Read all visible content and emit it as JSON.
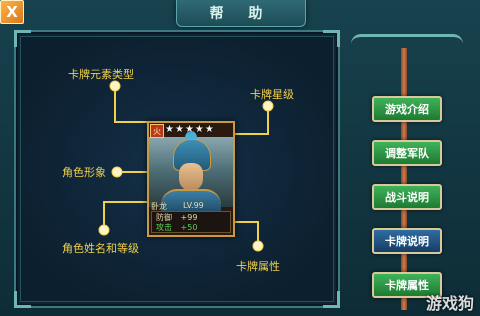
{
  "window": {
    "title": "帮 助",
    "close_label": "X"
  },
  "diagram": {
    "labels": {
      "element_type": "卡牌元素类型",
      "star_level": "卡牌星级",
      "portrait": "角色形象",
      "name_level": "角色姓名和等级",
      "attributes": "卡牌属性"
    }
  },
  "card": {
    "element": "火",
    "stars": [
      "★",
      "★",
      "★",
      "★",
      "★"
    ],
    "name": "卧龙",
    "level": "LV.99",
    "stats": [
      {
        "label": "防御",
        "value": "+99"
      },
      {
        "label": "攻击",
        "value": "+50"
      }
    ]
  },
  "sidebar": {
    "buttons": [
      {
        "label": "游戏介绍",
        "style": "green"
      },
      {
        "label": "调整军队",
        "style": "green"
      },
      {
        "label": "战斗说明",
        "style": "green"
      },
      {
        "label": "卡牌说明",
        "style": "blue"
      },
      {
        "label": "卡牌属性",
        "style": "green"
      }
    ]
  },
  "watermark": "游戏狗",
  "colors": {
    "label": "#f3d04a",
    "line": "#f3d04a",
    "frame": "#3b7a82"
  }
}
